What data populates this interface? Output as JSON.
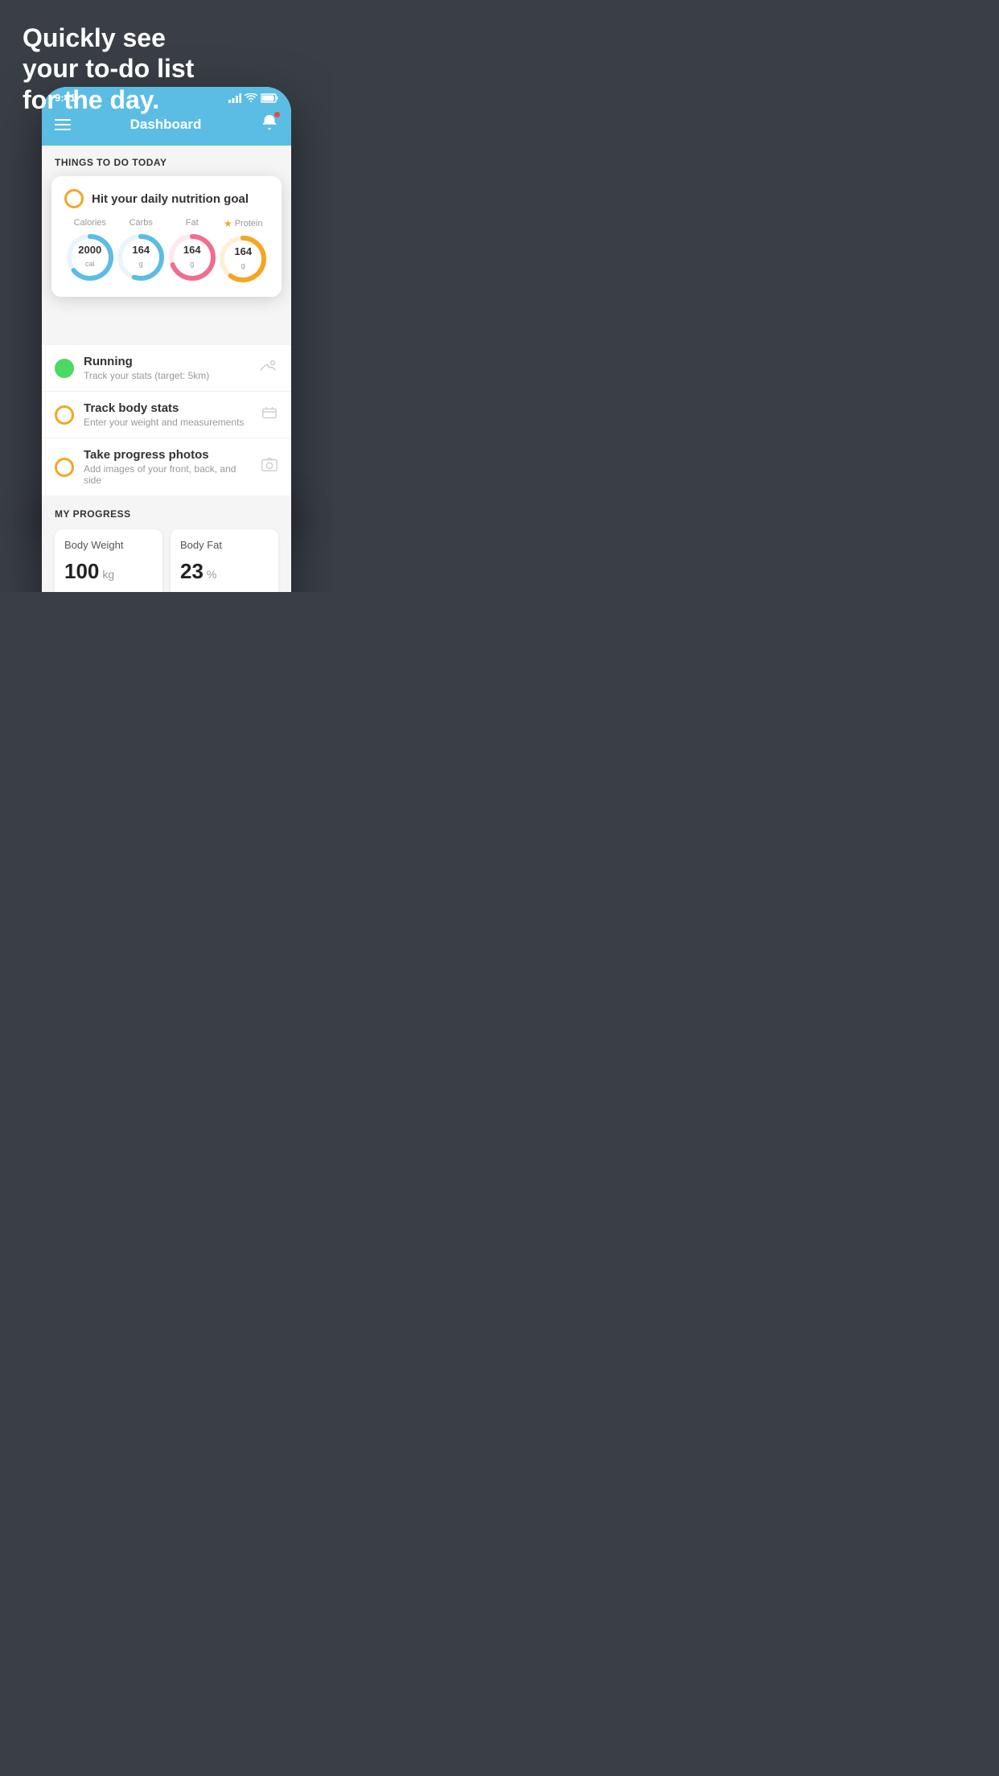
{
  "hero": {
    "line1": "Quickly see",
    "line2": "your to-do list",
    "line3": "for the day."
  },
  "statusBar": {
    "time": "9:41",
    "signal": "▎▍▋█",
    "wifi": "wifi",
    "battery": "battery"
  },
  "nav": {
    "title": "Dashboard"
  },
  "thingsToDoSection": {
    "title": "THINGS TO DO TODAY"
  },
  "nutritionCard": {
    "title": "Hit your daily nutrition goal",
    "calories": {
      "label": "Calories",
      "value": "2000",
      "unit": "cal",
      "color": "#5bbde4",
      "percent": 65
    },
    "carbs": {
      "label": "Carbs",
      "value": "164",
      "unit": "g",
      "color": "#5bbde4",
      "percent": 55
    },
    "fat": {
      "label": "Fat",
      "value": "164",
      "unit": "g",
      "color": "#f06e8e",
      "percent": 70
    },
    "protein": {
      "label": "Protein",
      "value": "164",
      "unit": "g",
      "color": "#f5a623",
      "percent": 60,
      "starred": true
    }
  },
  "listItems": [
    {
      "title": "Running",
      "subtitle": "Track your stats (target: 5km)",
      "radioColor": "green",
      "icon": "👟"
    },
    {
      "title": "Track body stats",
      "subtitle": "Enter your weight and measurements",
      "radioColor": "yellow",
      "icon": "⚖️"
    },
    {
      "title": "Take progress photos",
      "subtitle": "Add images of your front, back, and side",
      "radioColor": "yellow",
      "icon": "🖼️"
    }
  ],
  "progressSection": {
    "title": "MY PROGRESS",
    "cards": [
      {
        "title": "Body Weight",
        "value": "100",
        "unit": "kg"
      },
      {
        "title": "Body Fat",
        "value": "23",
        "unit": "%"
      }
    ]
  }
}
